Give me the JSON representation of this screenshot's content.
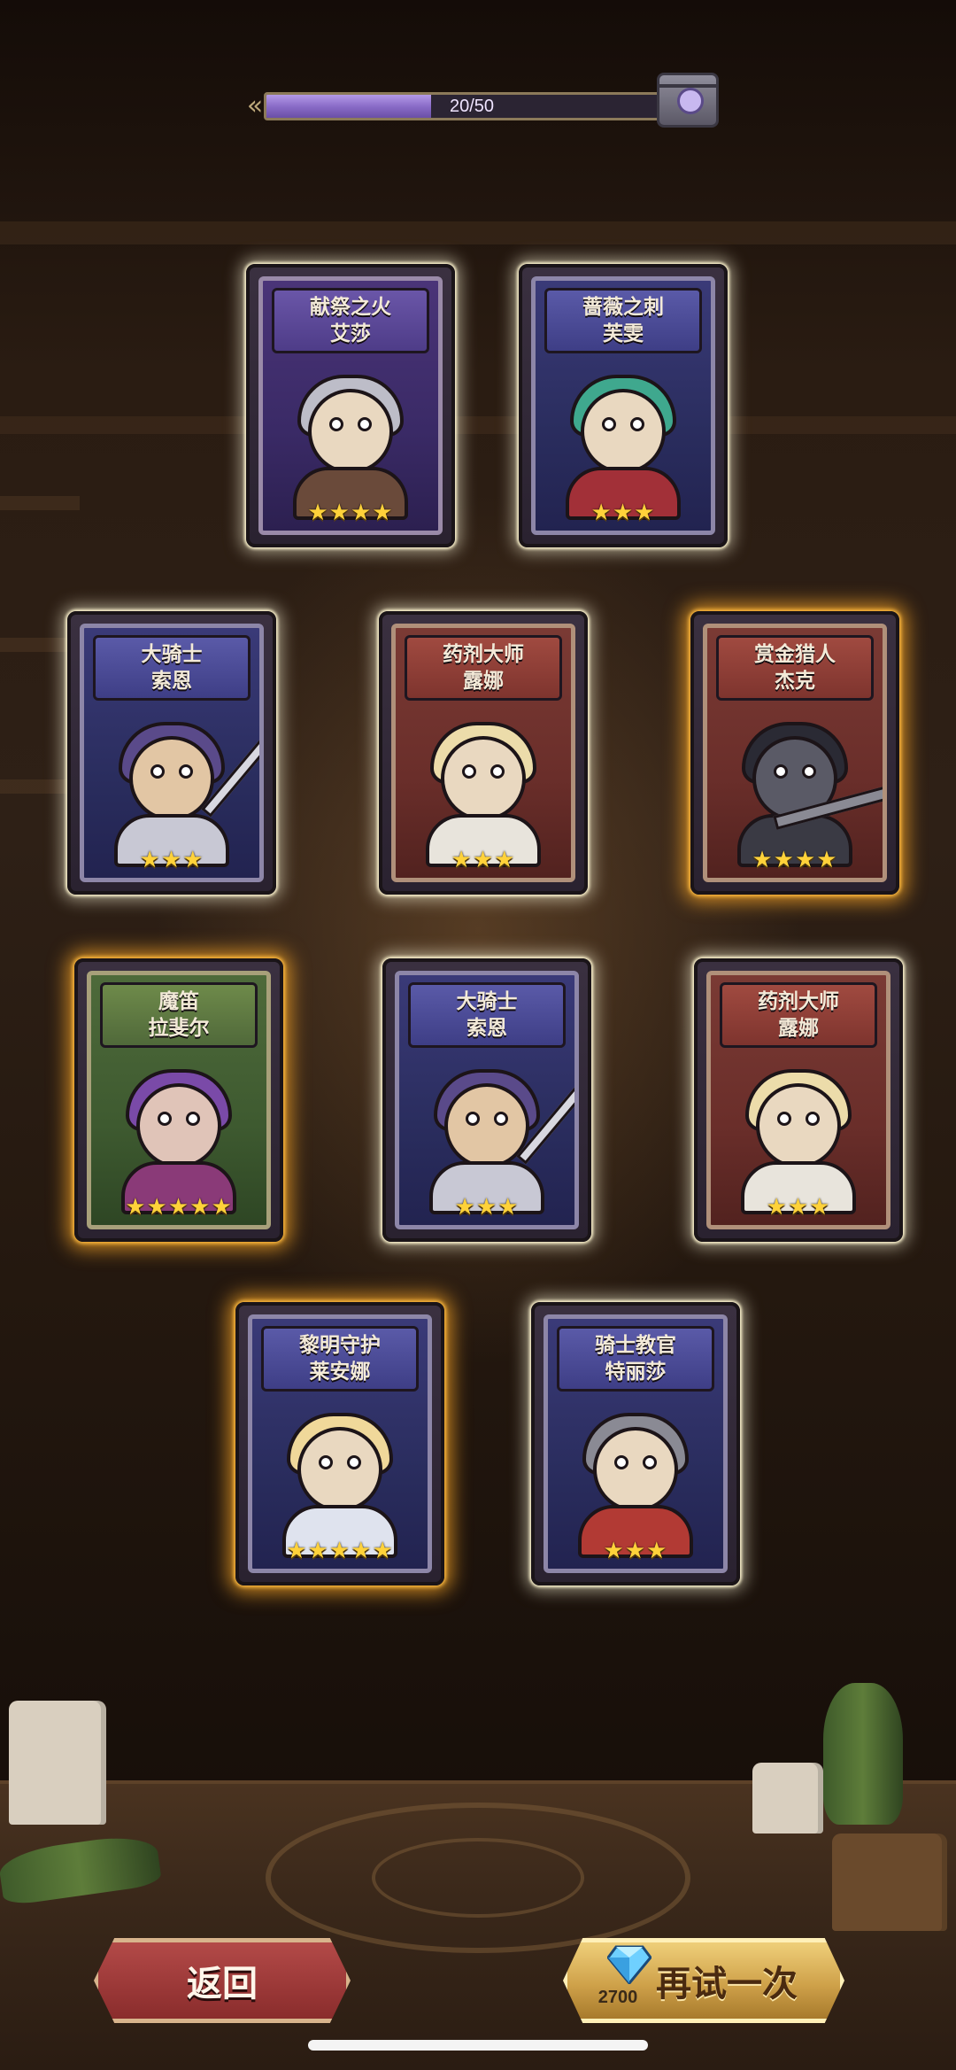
{
  "progress": {
    "current_text": "20/50",
    "fill_fraction": 0.4
  },
  "cards": [
    {
      "line1": "献祭之火",
      "line2": "艾莎",
      "stars": "★★★★",
      "star_count": 4
    },
    {
      "line1": "蔷薇之刺",
      "line2": "芙雯",
      "stars": "★★★",
      "star_count": 3
    },
    {
      "line1": "大骑士",
      "line2": "索恩",
      "stars": "★★★",
      "star_count": 3
    },
    {
      "line1": "药剂大师",
      "line2": "露娜",
      "stars": "★★★",
      "star_count": 3
    },
    {
      "line1": "赏金猎人",
      "line2": "杰克",
      "stars": "★★★★",
      "star_count": 4
    },
    {
      "line1": "魔笛",
      "line2": "拉斐尔",
      "stars": "★★★★★",
      "star_count": 5
    },
    {
      "line1": "大骑士",
      "line2": "索恩",
      "stars": "★★★",
      "star_count": 3
    },
    {
      "line1": "药剂大师",
      "line2": "露娜",
      "stars": "★★★",
      "star_count": 3
    },
    {
      "line1": "黎明守护",
      "line2": "莱安娜",
      "stars": "★★★★★",
      "star_count": 5
    },
    {
      "line1": "骑士教官",
      "line2": "特丽莎",
      "stars": "★★★",
      "star_count": 3
    }
  ],
  "buttons": {
    "back_label": "返回",
    "retry_label": "再试一次",
    "retry_cost": "2700"
  },
  "colors": {
    "glow_gold": "#ffaa28",
    "star": "#ffd23a",
    "progress_fill": "#8a6cc8"
  }
}
